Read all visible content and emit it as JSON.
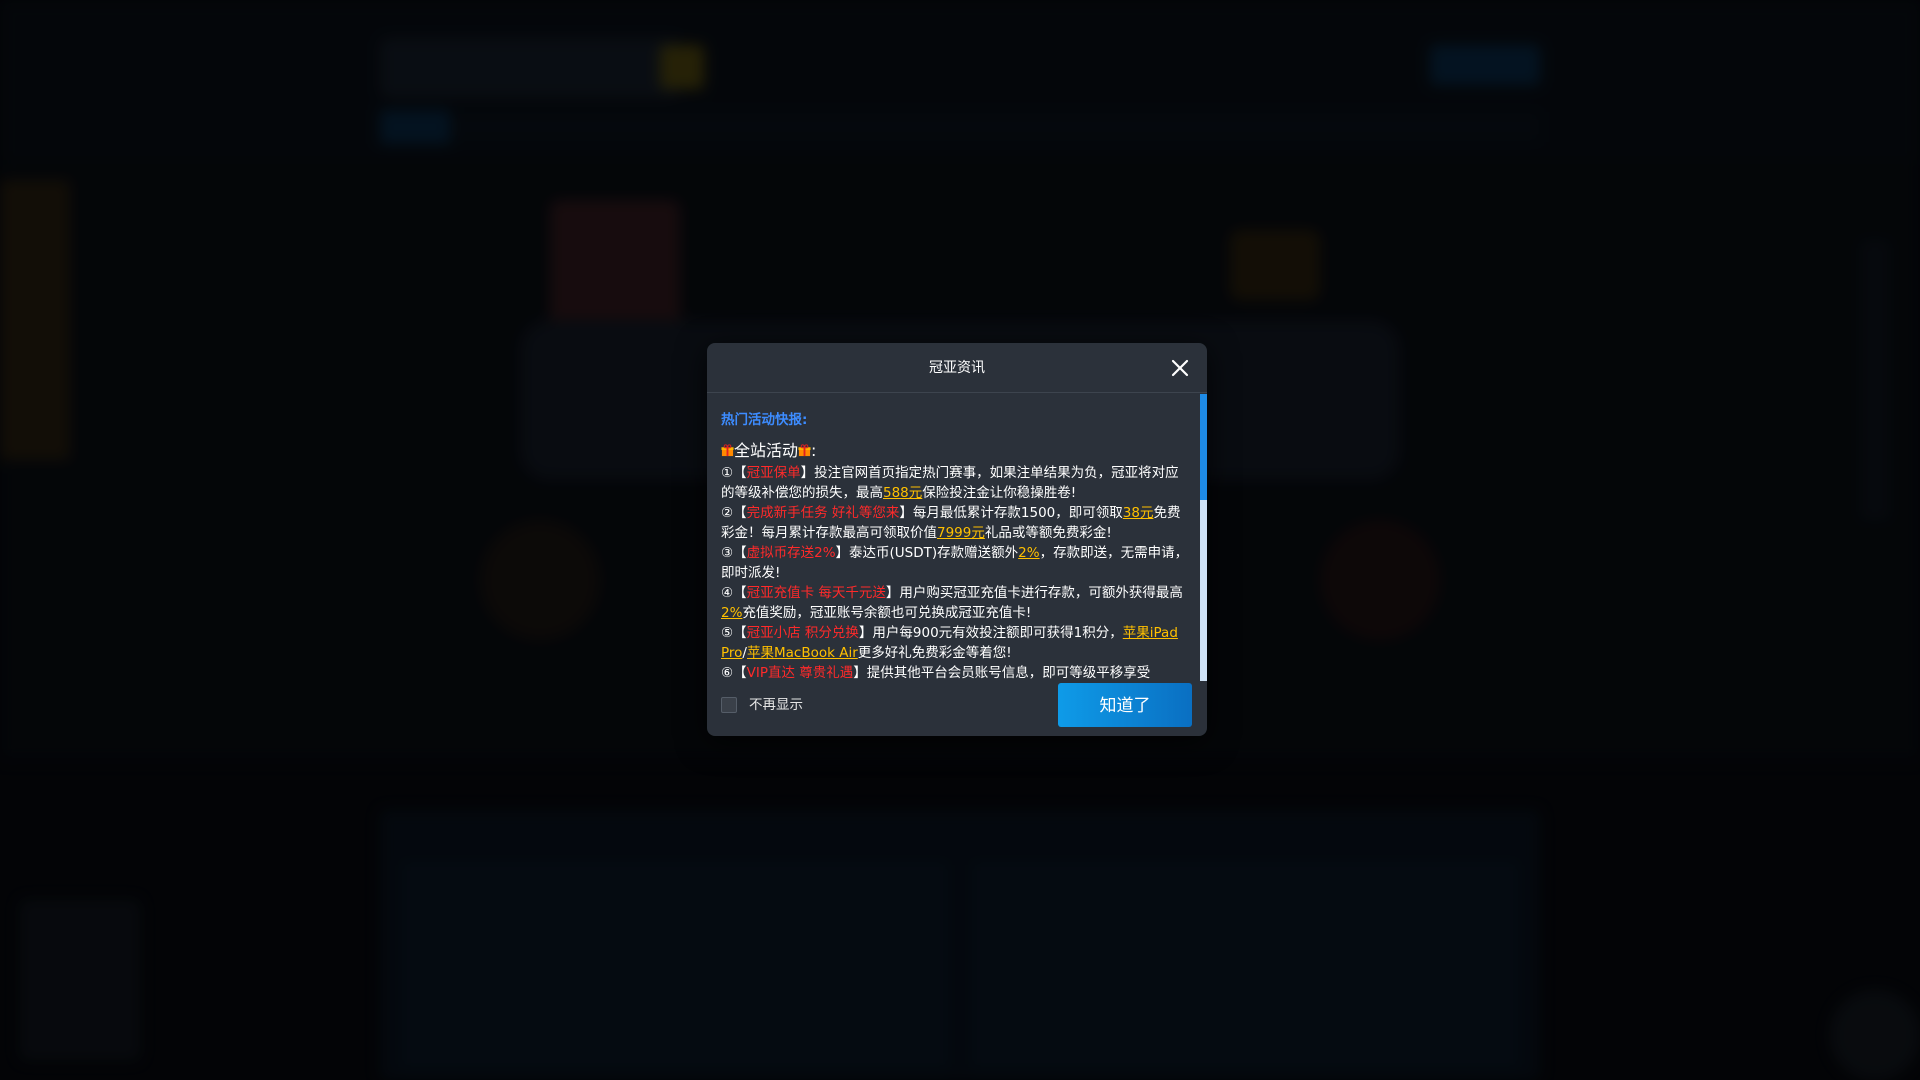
{
  "modal": {
    "title": "冠亚资讯",
    "section_title": "热门活动快报:",
    "event_title": "全站活动",
    "event_title_suffix": ":",
    "items": [
      {
        "num": "①",
        "lb": "【",
        "tag": "冠亚保单",
        "rb": "】",
        "text1": "投注官网首页指定热门赛事，如果注单结果为负，冠亚将对应的等级补偿您的损失，最高",
        "hl1": "588元",
        "text2": "保险投注金让你稳操胜卷!"
      },
      {
        "num": "②",
        "lb": "【",
        "tag": "完成新手任务 好礼等您来",
        "rb": "】",
        "text1": "每月最低累计存款1500，即可领取",
        "hl1": "38元",
        "text2": "免费彩金！每月累计存款最高可领取价值",
        "hl2": "7999元",
        "text3": "礼品或等额免费彩金!"
      },
      {
        "num": "③",
        "lb": "【",
        "tag": "虚拟币存送2%",
        "rb": "】",
        "text1": "泰达币(USDT)存款赠送额外",
        "hl1": "2%",
        "text2": "，存款即送，无需申请，即时派发!"
      },
      {
        "num": "④",
        "lb": "【",
        "tag": "冠亚充值卡 每天千元送",
        "rb": "】",
        "text1": "用户购买冠亚充值卡进行存款，可额外获得最高",
        "hl1": "2%",
        "text2": "充值奖励，冠亚账号余额也可兑换成冠亚充值卡!"
      },
      {
        "num": "⑤",
        "lb": "【",
        "tag": "冠亚小店 积分兑换",
        "rb": "】",
        "text1": "用户每900元有效投注额即可获得1积分，",
        "hl1": "苹果iPad Pro",
        "sep": "/",
        "hl2": "苹果MacBook Air",
        "text2": "更多好礼免费彩金等着您!"
      },
      {
        "num": "⑥",
        "lb": "【",
        "tag": "VIP直达 尊贵礼遇",
        "rb": "】",
        "text1": "提供其他平台会员账号信息，即可等级平移享受"
      }
    ],
    "dont_show_label": "不再显示",
    "ok_label": "知道了"
  },
  "colors": {
    "modal_bg": "#2b313a",
    "section_title": "#3d8cff",
    "tag_red": "#ff2a2a",
    "highlight_gold": "#ffc000",
    "button_blue": "#0e9be8",
    "scroll_thumb": "#1e8be6"
  },
  "icons": {
    "gift": "gift-icon",
    "close": "close-icon"
  }
}
